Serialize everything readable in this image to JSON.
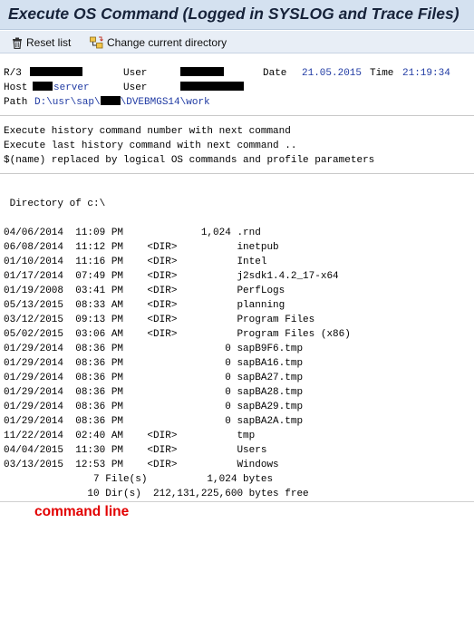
{
  "window": {
    "title": "Execute OS Command (Logged in SYSLOG and Trace Files)"
  },
  "toolbar": {
    "reset_label": "Reset list",
    "change_dir_label": "Change current directory"
  },
  "header": {
    "r3_label": "R/3",
    "user_label": "User",
    "user2_label": "User",
    "date_label": "Date",
    "date_value": "21.05.2015",
    "time_label": "Time",
    "time_value": "21:19:34",
    "host_label": "Host",
    "host_suffix": "server",
    "path_label": "Path",
    "path_part1": "D:\\usr\\sap\\",
    "path_part2": "\\DVEBMGS14\\work"
  },
  "help_lines": [
    "Execute history command number with next command",
    "Execute last history command with next command ..",
    "$(name) replaced by logical OS commands and profile parameters"
  ],
  "directory_header": " Directory of c:\\",
  "listing": [
    "04/06/2014  11:09 PM             1,024 .rnd",
    "06/08/2014  11:12 PM    <DIR>          inetpub",
    "01/10/2014  11:16 PM    <DIR>          Intel",
    "01/17/2014  07:49 PM    <DIR>          j2sdk1.4.2_17-x64",
    "01/19/2008  03:41 PM    <DIR>          PerfLogs",
    "05/13/2015  08:33 AM    <DIR>          planning",
    "03/12/2015  09:13 PM    <DIR>          Program Files",
    "05/02/2015  03:06 AM    <DIR>          Program Files (x86)",
    "01/29/2014  08:36 PM                 0 sapB9F6.tmp",
    "01/29/2014  08:36 PM                 0 sapBA16.tmp",
    "01/29/2014  08:36 PM                 0 sapBA27.tmp",
    "01/29/2014  08:36 PM                 0 sapBA28.tmp",
    "01/29/2014  08:36 PM                 0 sapBA29.tmp",
    "01/29/2014  08:36 PM                 0 sapBA2A.tmp",
    "11/22/2014  02:40 AM    <DIR>          tmp",
    "04/04/2015  11:30 PM    <DIR>          Users",
    "03/13/2015  12:53 PM    <DIR>          Windows"
  ],
  "summary": [
    "               7 File(s)          1,024 bytes",
    "              10 Dir(s)  212,131,225,600 bytes free"
  ],
  "command_line": {
    "label": "command line"
  },
  "colors": {
    "title_bar": "#d4e1f0",
    "toolbar": "#e8eef6",
    "header_value": "#1f3aa3",
    "command_label": "#e20000"
  }
}
